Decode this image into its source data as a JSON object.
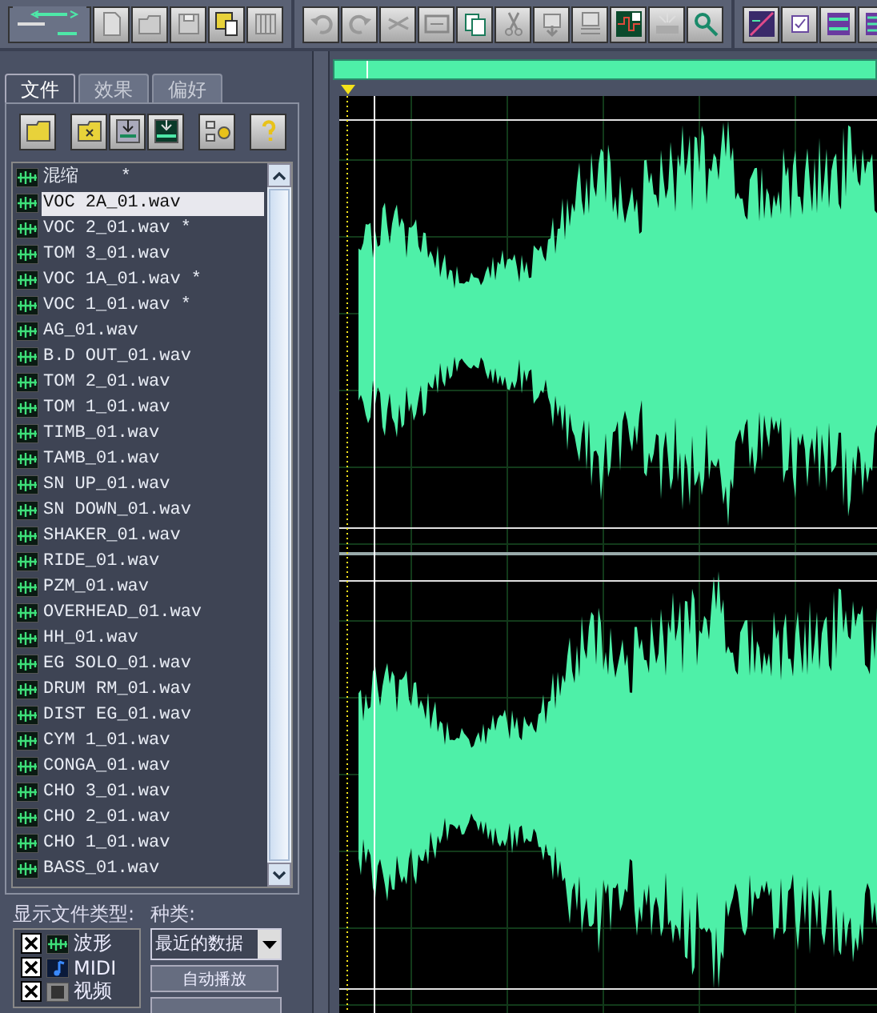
{
  "panel_tabs": [
    {
      "label": "文件",
      "selected": true
    },
    {
      "label": "效果",
      "selected": false
    },
    {
      "label": "偏好",
      "selected": false
    }
  ],
  "files": [
    {
      "name": "混缩    *",
      "selected": false
    },
    {
      "name": "VOC 2A_01.wav",
      "selected": true
    },
    {
      "name": "VOC 2_01.wav *",
      "selected": false
    },
    {
      "name": "TOM 3_01.wav",
      "selected": false
    },
    {
      "name": "VOC 1A_01.wav *",
      "selected": false
    },
    {
      "name": "VOC 1_01.wav *",
      "selected": false
    },
    {
      "name": "AG_01.wav",
      "selected": false
    },
    {
      "name": "B.D OUT_01.wav",
      "selected": false
    },
    {
      "name": "TOM 2_01.wav",
      "selected": false
    },
    {
      "name": "TOM 1_01.wav",
      "selected": false
    },
    {
      "name": "TIMB_01.wav",
      "selected": false
    },
    {
      "name": "TAMB_01.wav",
      "selected": false
    },
    {
      "name": "SN UP_01.wav",
      "selected": false
    },
    {
      "name": "SN DOWN_01.wav",
      "selected": false
    },
    {
      "name": "SHAKER_01.wav",
      "selected": false
    },
    {
      "name": "RIDE_01.wav",
      "selected": false
    },
    {
      "name": "PZM_01.wav",
      "selected": false
    },
    {
      "name": "OVERHEAD_01.wav",
      "selected": false
    },
    {
      "name": "HH_01.wav",
      "selected": false
    },
    {
      "name": "EG SOLO_01.wav",
      "selected": false
    },
    {
      "name": "DRUM RM_01.wav",
      "selected": false
    },
    {
      "name": "DIST EG_01.wav",
      "selected": false
    },
    {
      "name": "CYM 1_01.wav",
      "selected": false
    },
    {
      "name": "CONGA_01.wav",
      "selected": false
    },
    {
      "name": "CHO 3_01.wav",
      "selected": false
    },
    {
      "name": "CHO 2_01.wav",
      "selected": false
    },
    {
      "name": "CHO 1_01.wav",
      "selected": false
    },
    {
      "name": "BASS_01.wav",
      "selected": false
    }
  ],
  "filter": {
    "label": "显示文件类型:",
    "types": [
      {
        "label": "波形",
        "kind": "wave",
        "checked": true
      },
      {
        "label": "MIDI",
        "kind": "midi",
        "checked": true
      },
      {
        "label": "视频",
        "kind": "video",
        "checked": true
      }
    ]
  },
  "sort": {
    "label": "种类:",
    "value": "最近的数据"
  },
  "autoplay_button": "自动播放"
}
